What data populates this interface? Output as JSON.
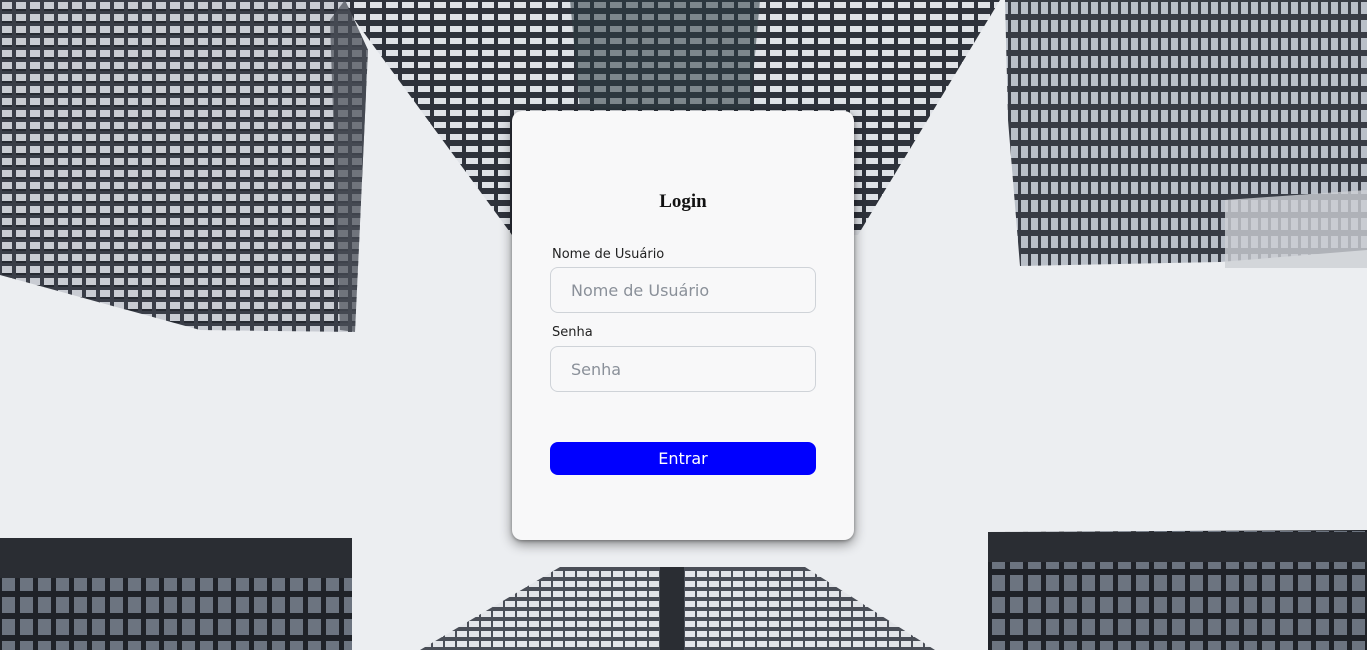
{
  "login": {
    "title": "Login",
    "username_label": "Nome de Usuário",
    "username_placeholder": "Nome de Usuário",
    "username_value": "",
    "password_label": "Senha",
    "password_placeholder": "Senha",
    "password_value": "",
    "submit_label": "Entrar"
  },
  "colors": {
    "submit_button": "#0000ff",
    "card_background": "#f8f8f9",
    "sky": "#eceef1"
  }
}
